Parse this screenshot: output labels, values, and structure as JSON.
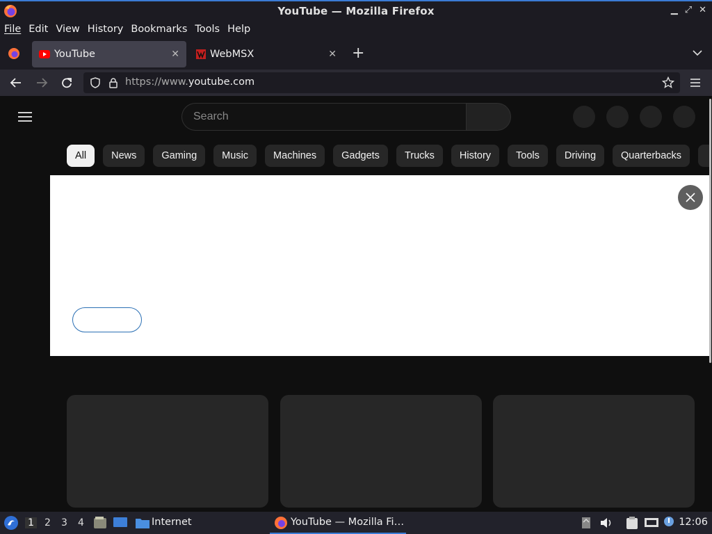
{
  "window": {
    "title": "YouTube — Mozilla Firefox"
  },
  "menu": [
    "File",
    "Edit",
    "View",
    "History",
    "Bookmarks",
    "Tools",
    "Help"
  ],
  "tabs": [
    {
      "label": "YouTube",
      "active": true
    },
    {
      "label": "WebMSX",
      "active": false
    }
  ],
  "address": {
    "prefix": "https://www.",
    "domain": "youtube.com"
  },
  "youtube": {
    "search_placeholder": "Search",
    "chips": [
      "All",
      "News",
      "Gaming",
      "Music",
      "Machines",
      "Gadgets",
      "Trucks",
      "History",
      "Tools",
      "Driving",
      "Quarterbacks"
    ]
  },
  "taskbar": {
    "workspaces": [
      "1",
      "2",
      "3",
      "4"
    ],
    "internet_label": "Internet",
    "active_task": "YouTube — Mozilla Fi…",
    "clock": "12:06"
  },
  "colors": {
    "accent": "#3a7bd5",
    "youtube_red": "#ff0000",
    "chip_selected": "#f1f1f1"
  }
}
